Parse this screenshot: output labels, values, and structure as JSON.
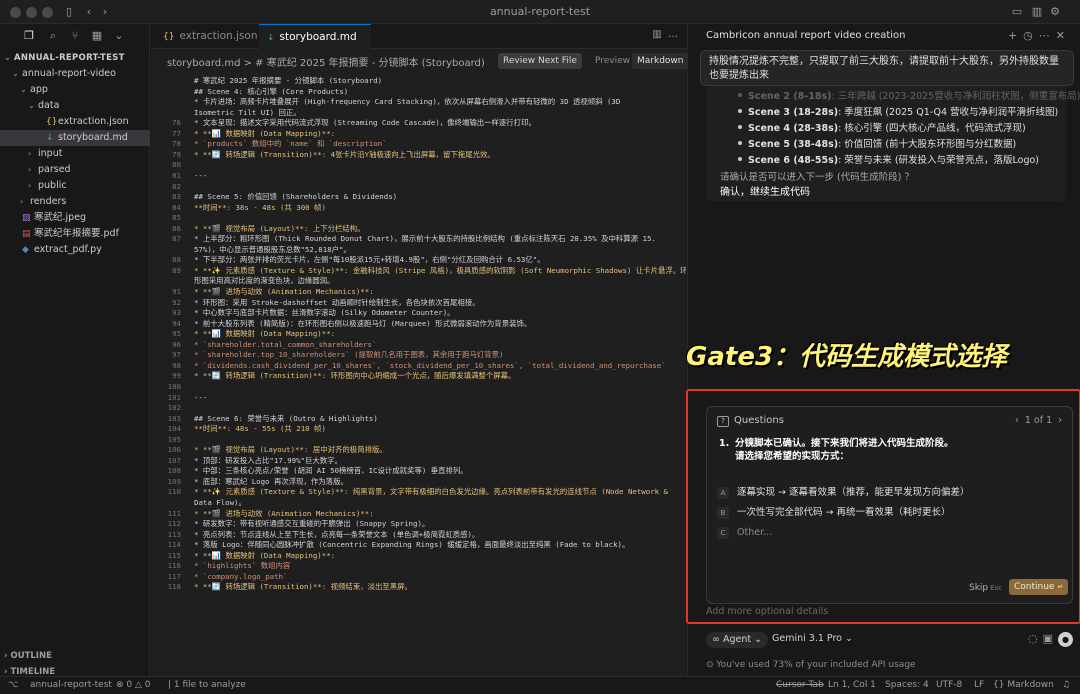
{
  "window": {
    "title": "annual-report-test"
  },
  "sidebar": {
    "tree": [
      {
        "label": "ANNUAL-REPORT-TEST",
        "indent": 0,
        "kind": "root"
      },
      {
        "label": "annual-report-video",
        "indent": 1,
        "kind": "folder-open"
      },
      {
        "label": "app",
        "indent": 2,
        "kind": "folder-open"
      },
      {
        "label": "data",
        "indent": 3,
        "kind": "folder-open"
      },
      {
        "label": "extraction.json",
        "indent": 4,
        "kind": "json"
      },
      {
        "label": "storyboard.md",
        "indent": 4,
        "kind": "md",
        "selected": true
      },
      {
        "label": "input",
        "indent": 3,
        "kind": "folder"
      },
      {
        "label": "parsed",
        "indent": 3,
        "kind": "folder"
      },
      {
        "label": "public",
        "indent": 3,
        "kind": "folder"
      },
      {
        "label": "renders",
        "indent": 2,
        "kind": "folder"
      },
      {
        "label": "寒武纪.jpeg",
        "indent": 1,
        "kind": "img"
      },
      {
        "label": "寒武纪年报摘要.pdf",
        "indent": 1,
        "kind": "pdf"
      },
      {
        "label": "extract_pdf.py",
        "indent": 1,
        "kind": "py"
      }
    ],
    "outline_label": "OUTLINE",
    "timeline_label": "TIMELINE"
  },
  "editor": {
    "tabs": [
      {
        "label": "extraction.json",
        "icon": "{}",
        "active": false
      },
      {
        "label": "storyboard.md",
        "icon": "↓",
        "active": true
      }
    ],
    "breadcrumb": "storyboard.md > # 寒武纪 2025 年报摘要 - 分镜脚本 (Storyboard)",
    "review_button": "Review Next File",
    "preview_label": "Preview",
    "markdown_label": "Markdown",
    "lines": [
      {
        "n": "",
        "t": "# 寒武纪 2025 年报摘要 - 分镜脚本 (Storyboard)"
      },
      {
        "n": "",
        "t": "## Scene 4: 核心引擎 (Core Products)"
      },
      {
        "n": "",
        "t": "    *   卡片进场：高频卡片堆叠展开 (High-frequency Card Stacking)，依次从屏幕右侧滑入并带有轻微的 3D 透视倾斜 (3D"
      },
      {
        "n": "",
        "t": "Isometric Tilt UI) 回正。"
      },
      {
        "n": "76",
        "t": "    *   文本呈现：描述文字采用代码流式浮现 (Streaming Code Cascade)，像终端输出一样逐行打印。"
      },
      {
        "n": "77",
        "t": "*   **📊 数据映射 (Data Mapping)**:"
      },
      {
        "n": "78",
        "t": "    *   `products` 数组中的 `name` 和 `description`"
      },
      {
        "n": "79",
        "t": "*   **🔄 转场逻辑 (Transition)**: 4张卡片沿Y轴极速向上飞出屏幕，留下拖尾光效。"
      },
      {
        "n": "80",
        "t": ""
      },
      {
        "n": "81",
        "t": "---"
      },
      {
        "n": "82",
        "t": ""
      },
      {
        "n": "83",
        "t": "## Scene 5: 价值回馈 (Shareholders & Dividends)"
      },
      {
        "n": "84",
        "t": "**时间**: 38s - 48s (共 300 帧)"
      },
      {
        "n": "85",
        "t": ""
      },
      {
        "n": "86",
        "t": "*   **🎬 视觉布局 (Layout)**: 上下分栏结构。"
      },
      {
        "n": "87",
        "t": "    *   上半部分：粗环形图 (Thick Rounded Donut Chart)，展示前十大股东的持股比例结构 (重点标注陈天石 28.35% 及中科算源 15."
      },
      {
        "n": "",
        "t": "57%)，中心显示普通股股东总数\"52,818户\"。"
      },
      {
        "n": "88",
        "t": "    *   下半部分：两张并排的荧光卡片，左侧\"每10股派15元+转增4.9股\"，右侧\"分红及回购合计 6.53亿\"。"
      },
      {
        "n": "89",
        "t": "*   **✨ 元素质感 (Texture & Style)**: 金融科技风 (Stripe 风格)，极具质感的软阴影 (Soft Neumorphic Shadows) 让卡片悬浮。环"
      },
      {
        "n": "",
        "t": "形图采用高对比度的渐变色块，边缘圆润。"
      },
      {
        "n": "91",
        "t": "*   **🎬 进场与动效 (Animation Mechanics)**:"
      },
      {
        "n": "92",
        "t": "    *   环形图：采用 Stroke-dashoffset 动画顺时针绘制生长，各色块依次首尾相接。"
      },
      {
        "n": "93",
        "t": "    *   中心数字与底部卡片数据：丝滑数字滚动 (Silky Odometer Counter)。"
      },
      {
        "n": "94",
        "t": "    *   前十大股东列表 (精简版)：在环形图右侧以极速跑马灯 (Marquee) 形式微弱滚动作为背景装饰。"
      },
      {
        "n": "95",
        "t": "*   **📊 数据映射 (Data Mapping)**:"
      },
      {
        "n": "96",
        "t": "    *   `shareholder.total_common_shareholders`"
      },
      {
        "n": "97",
        "t": "    *   `shareholder.top_10_shareholders` (提取前几名用于图表，其余用于跑马灯背景)"
      },
      {
        "n": "98",
        "t": "    *   `dividends.cash_dividend_per_10_shares`, `stock_dividend_per_10_shares`, `total_dividend_and_repurchase`"
      },
      {
        "n": "99",
        "t": "*   **🔄 转场逻辑 (Transition)**: 环形图向中心坍缩成一个光点，随后爆发填满整个屏幕。"
      },
      {
        "n": "100",
        "t": ""
      },
      {
        "n": "101",
        "t": "---"
      },
      {
        "n": "102",
        "t": ""
      },
      {
        "n": "103",
        "t": "## Scene 6: 荣誉与未来 (Outro & Highlights)"
      },
      {
        "n": "104",
        "t": "**时间**: 48s - 55s (共 210 帧)"
      },
      {
        "n": "105",
        "t": ""
      },
      {
        "n": "106",
        "t": "*   **🎬 视觉布局 (Layout)**: 居中对齐的极简排版。"
      },
      {
        "n": "107",
        "t": "    *   顶部：研发投入占比\"17.99%\"巨大数字。"
      },
      {
        "n": "108",
        "t": "    *   中部：三条核心亮点/荣誉 (胡润 AI 50榜榜首、IC设计成就奖等) 垂直排列。"
      },
      {
        "n": "109",
        "t": "    *   底部：寒武纪 Logo 再次浮现，作为落版。"
      },
      {
        "n": "110",
        "t": "*   **✨ 元素质感 (Texture & Style)**: 纯黑背景，文字带有极细的白色发光边缘。亮点列表前带有发光的连线节点 (Node Network &"
      },
      {
        "n": "",
        "t": "Data Flow)。"
      },
      {
        "n": "111",
        "t": "*   **🎬 进场与动效 (Animation Mechanics)**:"
      },
      {
        "n": "112",
        "t": "    *   研发数字：带有视听通感交互重碰的干脆弹出 (Snappy Spring)。"
      },
      {
        "n": "113",
        "t": "    *   亮点列表：节点连线从上至下生长，点亮每一条荣誉文本 (单色调+极简霓虹质感)。"
      },
      {
        "n": "114",
        "t": "    *   落版 Logo：伴随同心圆脉冲扩散 (Concentric Expanding Rings) 缓缓定格，画面最终淡出至纯黑 (Fade to black)。"
      },
      {
        "n": "115",
        "t": "*   **📊 数据映射 (Data Mapping)**:"
      },
      {
        "n": "116",
        "t": "    *   `highlights` 数组内容"
      },
      {
        "n": "117",
        "t": "    *   `company.logo_path`"
      },
      {
        "n": "118",
        "t": "*   **🔄 转场逻辑 (Transition)**: 视频结束，淡出至黑屏。"
      }
    ]
  },
  "chat": {
    "title": "Cambricon annual report video creation",
    "user_message": "持股情况提炼不完整，只提取了前三大股东，请提取前十大股东，另外持股数量也要提炼出来",
    "scenes": [
      {
        "bold": "Scene 2 (8-18s)",
        "rest": ": 三年跨越 (2023-2025营收与净利润柱状图，侧重宣布局)"
      },
      {
        "bold": "Scene 3 (18-28s)",
        "rest": ": 季度狂飙 (2025 Q1-Q4 营收与净利润平滑折线图)"
      },
      {
        "bold": "Scene 4 (28-38s)",
        "rest": ": 核心引擎 (四大核心产品线，代码流式浮现)"
      },
      {
        "bold": "Scene 5 (38-48s)",
        "rest": ": 价值回馈 (前十大股东环形图与分红数据)"
      },
      {
        "bold": "Scene 6 (48-55s)",
        "rest": ": 荣誉与未来 (研发投入与荣誉亮点，落版Logo)"
      }
    ],
    "confirm_question": "请确认是否可以进入下一步 (代码生成阶段) ？",
    "confirm_answer": "确认，继续生成代码",
    "gate_label": "Gate3：代码生成模式选择",
    "questions": {
      "header": "Questions",
      "pager": "1 of 1",
      "number": "1.",
      "text_line1": "分镜脚本已确认。接下来我们将进入代码生成阶段。",
      "text_line2": "请选择您希望的实现方式：",
      "options": [
        {
          "key": "A",
          "label": "逐幕实现 → 逐幕看效果（推荐，能更早发现方向偏差）"
        },
        {
          "key": "B",
          "label": "一次性写完全部代码 → 再统一看效果（耗时更长）"
        },
        {
          "key": "C",
          "label": "Other..."
        }
      ],
      "skip_label": "Skip",
      "skip_hint": "Esc",
      "continue_label": "Continue"
    },
    "input_placeholder": "Add more optional details",
    "agent_label": "Agent",
    "model_label": "Gemini 3.1 Pro",
    "usage_text": "You've used 73% of your included API usage"
  },
  "statusbar": {
    "workspace": "annual-report-test",
    "errors": "0",
    "warnings": "0",
    "analyze": "1 file to analyze",
    "cursor_tab": "Cursor Tab",
    "position": "Ln 1, Col 1",
    "spaces": "Spaces: 4",
    "encoding": "UTF-8",
    "eol": "LF",
    "language": "Markdown"
  }
}
